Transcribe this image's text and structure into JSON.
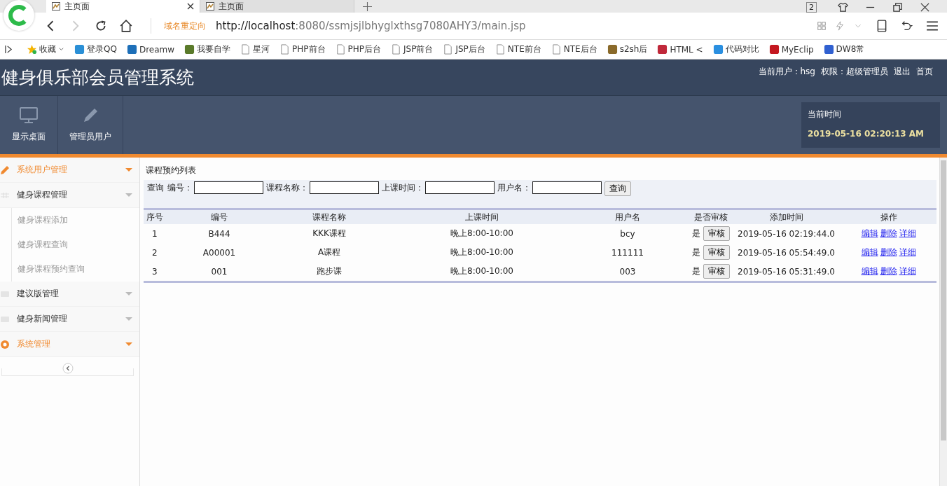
{
  "browser": {
    "tabs": [
      {
        "title": "主页面",
        "selected": true
      },
      {
        "title": "主页面",
        "selected": false
      }
    ],
    "tab_count": "2",
    "address": {
      "redirect_label": "域名重定向",
      "url_host": "http://localhost",
      "url_rest": ":8080/ssmjsjlbhyglxthsg7080AHY3/main.jsp"
    },
    "bookmarks": [
      {
        "label": "收藏",
        "kind": "star"
      },
      {
        "label": "登录QQ",
        "kind": "site",
        "color": "#2a8fd6"
      },
      {
        "label": "Dreamw",
        "kind": "site",
        "color": "#1d6fb8"
      },
      {
        "label": "我要自学",
        "kind": "site",
        "color": "#5a7a2a"
      },
      {
        "label": "星河",
        "kind": "page"
      },
      {
        "label": "PHP前台",
        "kind": "page"
      },
      {
        "label": "PHP后台",
        "kind": "page"
      },
      {
        "label": "JSP前台",
        "kind": "page"
      },
      {
        "label": "JSP后台",
        "kind": "page"
      },
      {
        "label": "NTE前台",
        "kind": "page"
      },
      {
        "label": "NTE后台",
        "kind": "page"
      },
      {
        "label": "s2sh后",
        "kind": "site",
        "color": "#8a6a2a"
      },
      {
        "label": "HTML <",
        "kind": "site",
        "color": "#c0283a"
      },
      {
        "label": "代码对比",
        "kind": "site",
        "color": "#2a8fe0"
      },
      {
        "label": "MyEclip",
        "kind": "site",
        "color": "#c41820"
      },
      {
        "label": "DW8常",
        "kind": "site",
        "color": "#3060d0"
      }
    ]
  },
  "app": {
    "title": "健身俱乐部会员管理系统",
    "user_info": [
      "当前用户：hsg",
      "权限：超级管理员"
    ],
    "header_links": [
      "退出",
      "首页"
    ],
    "toolbar": [
      {
        "label": "显示桌面",
        "kind": "monitor"
      },
      {
        "label": "管理员用户",
        "kind": "pencil"
      }
    ],
    "time_box": {
      "label": "当前时间",
      "value": "2019-05-16 02:20:13 AM"
    }
  },
  "sidebar": {
    "groups": [
      {
        "label": "系统用户管理",
        "active": true,
        "kind": "pencil"
      },
      {
        "label": "健身课程管理",
        "active": false,
        "kind": "grid",
        "children": [
          {
            "label": "健身课程添加"
          },
          {
            "label": "健身课程查询"
          },
          {
            "label": "健身课程预约查询"
          }
        ]
      },
      {
        "label": "建议版管理",
        "active": false,
        "kind": "card"
      },
      {
        "label": "健身新闻管理",
        "active": false,
        "kind": "card"
      },
      {
        "label": "系统管理",
        "active": true,
        "kind": "gear"
      }
    ]
  },
  "content": {
    "title": "课程预约列表",
    "search": {
      "label": "查询",
      "fields": [
        {
          "label": "编号："
        },
        {
          "label": "课程名称："
        },
        {
          "label": "上课时间："
        },
        {
          "label": "用户名："
        }
      ],
      "button": "查询"
    },
    "table": {
      "columns": [
        "序号",
        "编号",
        "课程名称",
        "上课时间",
        "用户名",
        "是否审核",
        "添加时间",
        "操作"
      ],
      "rows": [
        {
          "cells": [
            "1",
            "B444",
            "KKK课程",
            "晚上8:00-10:00",
            "bcy"
          ],
          "audited": "是",
          "audit_button": "审核",
          "added": "2019-05-16 02:19:44.0",
          "actions": [
            "编辑",
            "删除",
            "详细"
          ]
        },
        {
          "cells": [
            "2",
            "A00001",
            "A课程",
            "晚上8:00-10:00",
            "111111"
          ],
          "audited": "是",
          "audit_button": "审核",
          "added": "2019-05-16 05:54:49.0",
          "actions": [
            "编辑",
            "删除",
            "详细"
          ]
        },
        {
          "cells": [
            "3",
            "001",
            "跑步课",
            "晚上8:00-10:00",
            "003"
          ],
          "audited": "是",
          "audit_button": "审核",
          "added": "2019-05-16 05:31:49.0",
          "actions": [
            "编辑",
            "删除",
            "详细"
          ]
        }
      ]
    }
  }
}
